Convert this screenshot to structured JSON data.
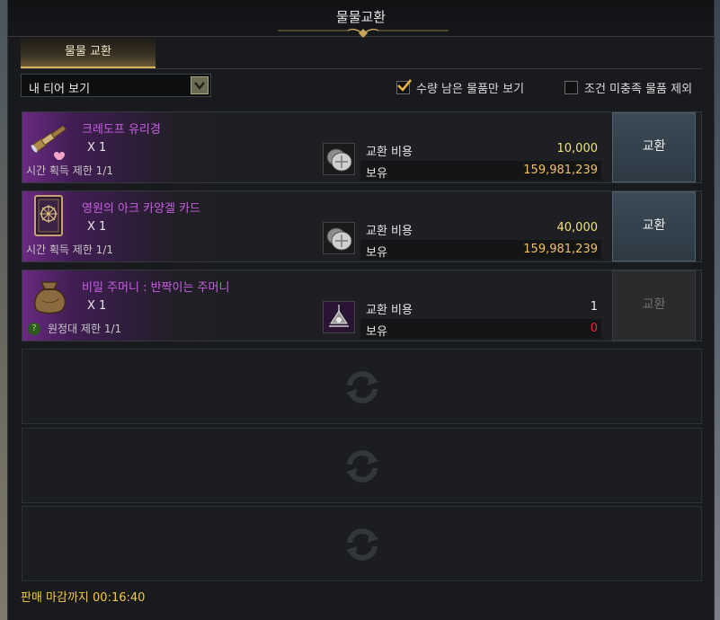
{
  "window": {
    "title": "물물교환"
  },
  "tabs": [
    {
      "label": "물물 교환"
    }
  ],
  "filter": {
    "dropdown_value": "내 티어 보기",
    "checkbox_remaining_label": "수량 남은 물품만 보기",
    "checkbox_remaining_checked": true,
    "checkbox_exclude_label": "조건 미충족 물품 제외",
    "checkbox_exclude_checked": false
  },
  "items": [
    {
      "name": "크레도프 유리경",
      "quantity": "X 1",
      "limit": "시간 획득 제한 1/1",
      "cost_label": "교환 비용",
      "cost_value": "10,000",
      "owned_label": "보유",
      "owned_value": "159,981,239",
      "button": "교환",
      "icon": "spyglass-icon",
      "cost_icon": "silver-coin-icon"
    },
    {
      "name": "영원의 아크 카양겔 카드",
      "quantity": "X 1",
      "limit": "시간 획득 제한 1/1",
      "cost_label": "교환 비용",
      "cost_value": "40,000",
      "owned_label": "보유",
      "owned_value": "159,981,239",
      "button": "교환",
      "icon": "card-icon",
      "cost_icon": "silver-coin-icon"
    },
    {
      "name": "비밀 주머니 : 반짝이는 주머니",
      "quantity": "X 1",
      "limit_badge": "?",
      "limit": "원정대 제한 1/1",
      "cost_label": "교환 비용",
      "cost_value": "1",
      "owned_label": "보유",
      "owned_value": "0",
      "button": "교환",
      "icon": "pouch-icon",
      "cost_icon": "pendant-icon"
    }
  ],
  "footer": {
    "deadline": "판매 마감까지 00:16:40"
  },
  "colors": {
    "item_name": "#c65fe0",
    "cost_gold": "#f2e27a",
    "owned_gold": "#f0c060",
    "insufficient_red": "#e03030",
    "footer_text": "#f0c84a",
    "tab_accent": "#d9b25e"
  }
}
